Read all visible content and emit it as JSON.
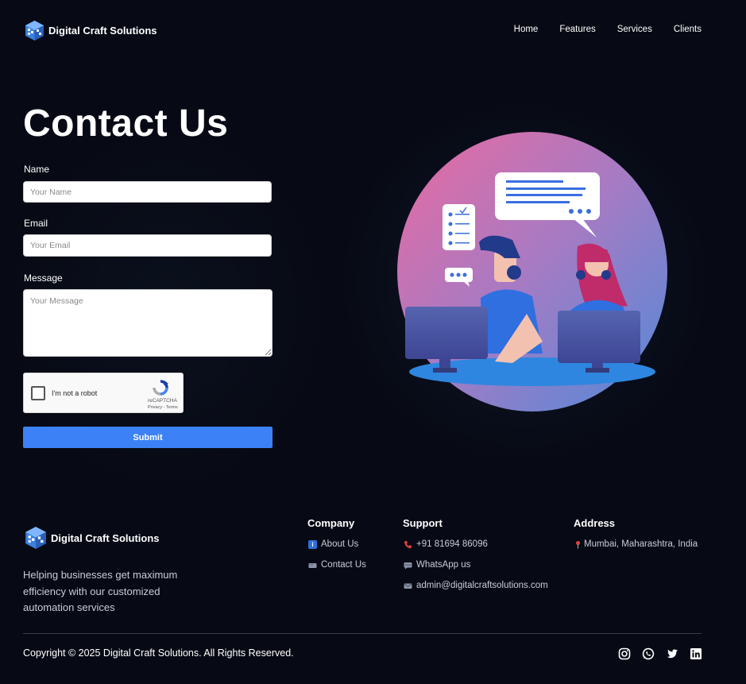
{
  "header": {
    "brand": "Digital Craft Solutions",
    "nav": [
      "Home",
      "Features",
      "Services",
      "Clients"
    ]
  },
  "contact": {
    "title": "Contact Us",
    "name_label": "Name",
    "name_placeholder": "Your Name",
    "email_label": "Email",
    "email_placeholder": "Your Email",
    "message_label": "Message",
    "message_placeholder": "Your Message",
    "recaptcha": {
      "label": "I'm not a robot",
      "brand": "reCAPTCHA",
      "links": "Privacy - Terms"
    },
    "submit_label": "Submit"
  },
  "footer": {
    "brand": "Digital Craft Solutions",
    "description": "Helping businesses get maximum efficiency with our customized automation services",
    "company": {
      "title": "Company",
      "links": [
        {
          "label": "About Us",
          "icon": "info-icon"
        },
        {
          "label": "Contact Us",
          "icon": "mailbox-icon"
        }
      ]
    },
    "support": {
      "title": "Support",
      "links": [
        {
          "label": "+91 81694 86096",
          "icon": "phone-icon"
        },
        {
          "label": "WhatsApp us",
          "icon": "chat-icon"
        },
        {
          "label": "admin@digitalcraftsolutions.com",
          "icon": "envelope-icon"
        }
      ]
    },
    "address": {
      "title": "Address",
      "text": "Mumbai, Maharashtra, India",
      "icon": "pin-icon"
    },
    "copyright": "Copyright © 2025 Digital Craft Solutions. All Rights Reserved.",
    "social": [
      "instagram-icon",
      "whatsapp-icon",
      "twitter-icon",
      "linkedin-icon"
    ]
  },
  "colors": {
    "background": "#070a14",
    "accent": "#3c82f6",
    "circle_top": "#e26aa0",
    "circle_bottom": "#5a8fd8"
  }
}
